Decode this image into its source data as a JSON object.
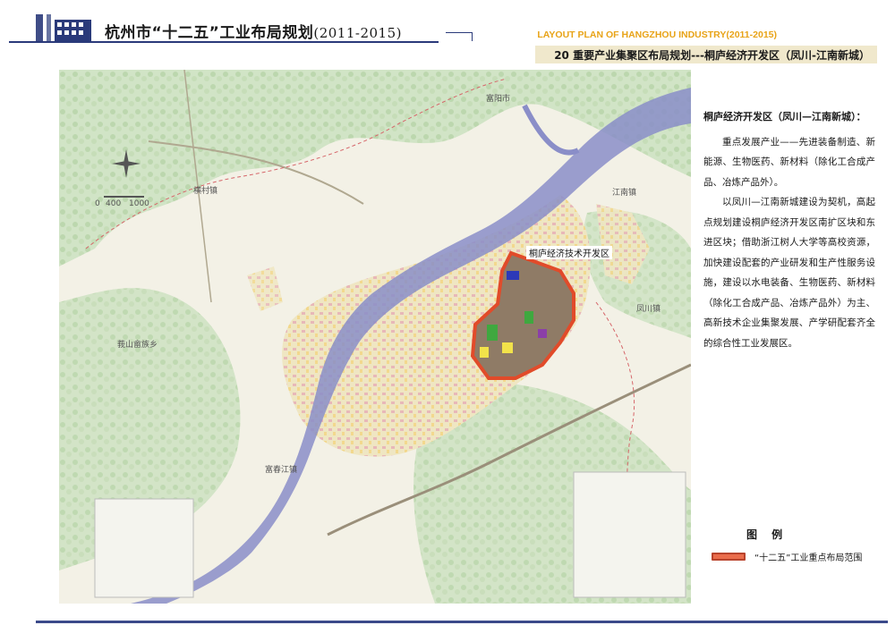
{
  "header": {
    "title_main": "杭州市“十二五”工业布局规划",
    "title_years": "(2011-2015)",
    "english_title": "LAYOUT PLAN OF HANGZHOU INDUSTRY(2011-2015)",
    "subtitle": "20 重要产业集聚区布局规划---桐庐经济开发区（凤川-江南新城）"
  },
  "map": {
    "labels": {
      "fuyang": "富阳市",
      "zone": "桐庐经济技术开发区",
      "fengchuan": "凤川镇",
      "jiangnan": "江南镇",
      "fengchuan_north": "凤川镇",
      "echuan": "莪山畲族乡",
      "fuchun": "富春江镇",
      "hengcun": "横村镇",
      "scale_0": "0",
      "scale_400": "400",
      "scale_1000": "1000"
    }
  },
  "description": {
    "heading": "桐庐经济开发区（凤川—江南新城）：",
    "paragraphs": [
      "重点发展产业——先进装备制造、新能源、生物医药、新材料（除化工合成产品、冶炼产品外）。",
      "以凤川—江南新城建设为契机，高起点规划建设桐庐经济开发区南扩区块和东进区块；借助浙江树人大学等高校资源，加快建设配套的产业研发和生产性服务设施，建设以水电装备、生物医药、新材料（除化工合成产品、冶炼产品外）为主、高新技术企业集聚发展、产学研配套齐全的综合性工业发展区。"
    ]
  },
  "legend": {
    "title": "图 例",
    "item": "“十二五”工业重点布局范围",
    "swatch_color": "#ea6b4a"
  },
  "colors": {
    "accent_navy": "#2a3a7a",
    "accent_orange": "#e8a317",
    "river": "#8a8ec8",
    "zone": "#e14b2a"
  }
}
